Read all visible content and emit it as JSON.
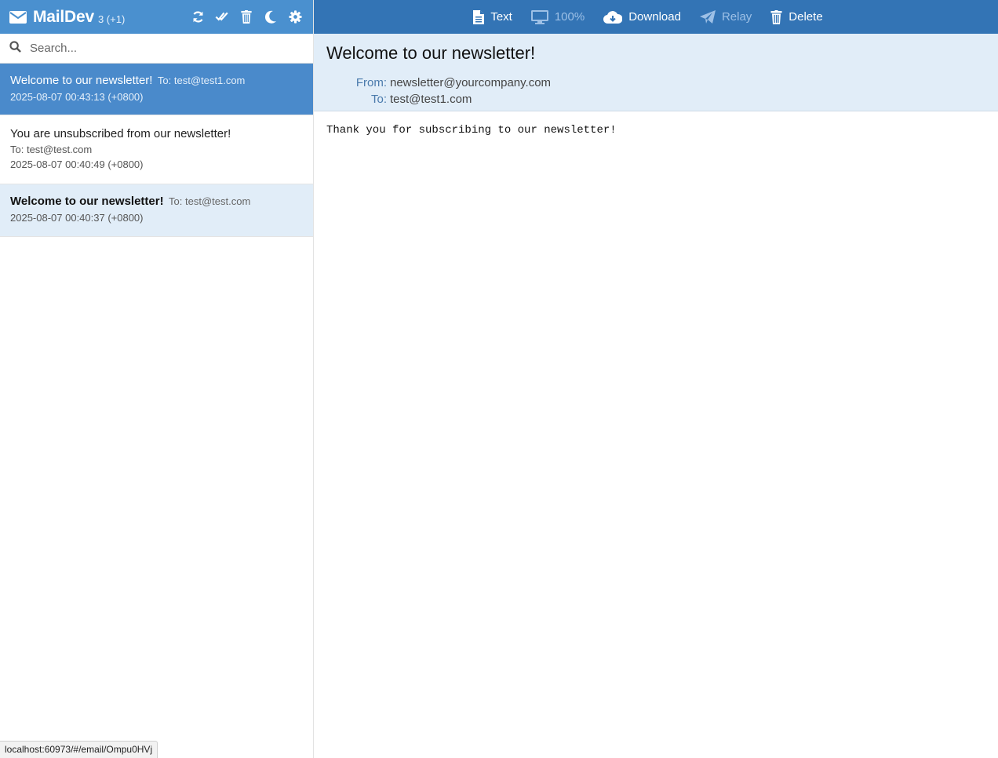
{
  "app": {
    "title": "MailDev",
    "count": "3 (+1)"
  },
  "header_actions": [
    "refresh-icon",
    "mark-all-read-icon",
    "trash-icon",
    "moon-icon",
    "gear-icon"
  ],
  "search": {
    "placeholder": "Search..."
  },
  "emails": [
    {
      "subject": "Welcome to our newsletter!",
      "to": "To: test@test1.com",
      "date": "2025-08-07 00:43:13 (+0800)",
      "state": "selected"
    },
    {
      "subject": "You are unsubscribed from our newsletter!",
      "to": "To: test@test.com",
      "date": "2025-08-07 00:40:49 (+0800)",
      "state": "read"
    },
    {
      "subject": "Welcome to our newsletter!",
      "to": "To: test@test.com",
      "date": "2025-08-07 00:40:37 (+0800)",
      "state": "unread"
    }
  ],
  "toolbar": {
    "text": "Text",
    "zoom": "100%",
    "download": "Download",
    "relay": "Relay",
    "delete": "Delete"
  },
  "message": {
    "subject": "Welcome to our newsletter!",
    "from_label": "From:",
    "from": "newsletter@yourcompany.com",
    "to_label": "To:",
    "to": "test@test1.com",
    "body": "Thank you for subscribing to our newsletter!"
  },
  "status_bar": {
    "url": "localhost:60973/#/email/Ompu0HVj"
  },
  "colors": {
    "sidebar_header": "#4a90cf",
    "toolbar": "#3374b5",
    "selected_item": "#4a8acb",
    "unread_item": "#e1edf8"
  }
}
